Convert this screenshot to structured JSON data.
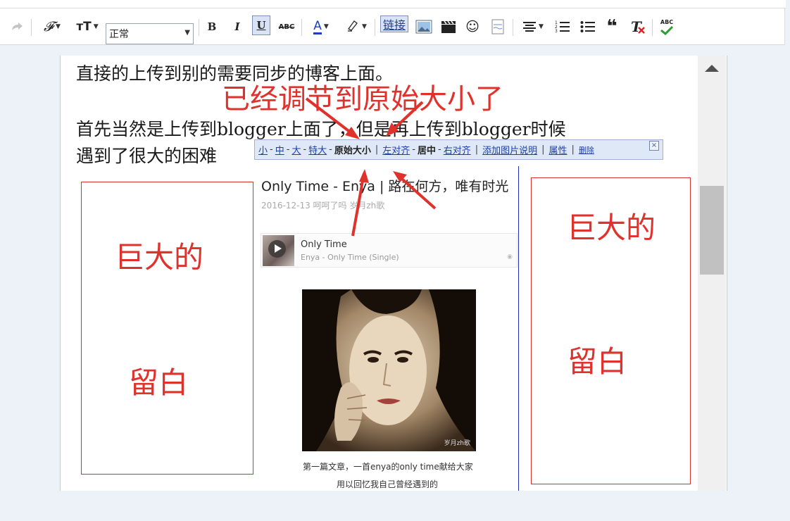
{
  "toolbar": {
    "redo_icon": "redo-icon",
    "font_label": "𝓕",
    "fontsize_label": "ᴛT",
    "format_value": "正常",
    "bold_label": "B",
    "italic_label": "I",
    "underline_label": "U",
    "strike_label": "ABC",
    "textcolor_label": "A",
    "link_label": "链接",
    "spell_label": "ABC"
  },
  "editor": {
    "line1": "直接的上传到别的需要同步的博客上面。",
    "line2": "首先当然是上传到blogger上面了，但是再上传到blogger时候",
    "line3": "遇到了很大的困难"
  },
  "annotations": {
    "top": "已经调节到原始大小了",
    "left_big": "巨大的",
    "left_blank": "留白",
    "right_big": "巨大的",
    "right_blank": "留白"
  },
  "image_bar": {
    "small": "小",
    "medium": "中",
    "large": "大",
    "xlarge": "特大",
    "original": "原始大小",
    "align_left": "左对齐",
    "center": "居中",
    "align_right": "右对齐",
    "add_caption": "添加图片说明",
    "properties": "属性",
    "remove": "删除",
    "close": "×"
  },
  "post": {
    "title": "Only Time - Enya | 路在何方，唯有时光",
    "meta": "2016-12-13  呵呵了吗  岁月zh歌",
    "song_name": "Only Time",
    "song_artist": "Enya - Only Time (Single)",
    "watermark": "岁月zh歌",
    "caption1": "第一篇文章，一首enya的only time献给大家",
    "caption2": "用以回忆我自己曾经遇到的"
  },
  "colors": {
    "annotation_red": "#e0322d",
    "link_blue": "#1d3fa8",
    "bar_bg": "#dfe8f6"
  }
}
